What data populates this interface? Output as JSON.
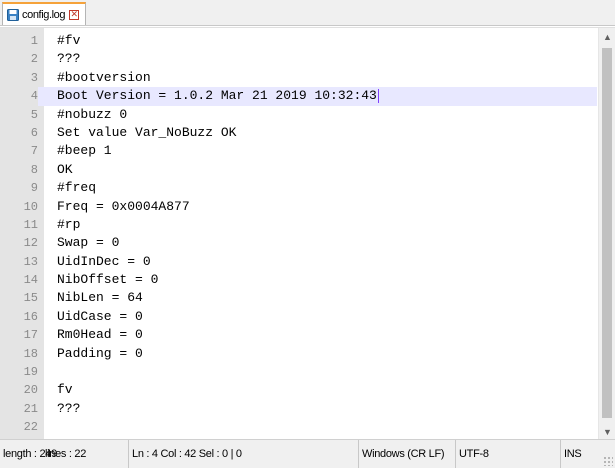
{
  "tab": {
    "label": "config.log",
    "icon": "save-icon",
    "close_icon": "close-icon"
  },
  "editor": {
    "lines": [
      {
        "n": "1",
        "text": "#fv"
      },
      {
        "n": "2",
        "text": "???"
      },
      {
        "n": "3",
        "text": "#bootversion"
      },
      {
        "n": "4",
        "text": "Boot Version = 1.0.2 Mar 21 2019 10:32:43"
      },
      {
        "n": "5",
        "text": "#nobuzz 0"
      },
      {
        "n": "6",
        "text": "Set value Var_NoBuzz OK"
      },
      {
        "n": "7",
        "text": "#beep 1"
      },
      {
        "n": "8",
        "text": "OK"
      },
      {
        "n": "9",
        "text": "#freq"
      },
      {
        "n": "10",
        "text": "Freq = 0x0004A877"
      },
      {
        "n": "11",
        "text": "#rp"
      },
      {
        "n": "12",
        "text": "Swap = 0"
      },
      {
        "n": "13",
        "text": "UidInDec = 0"
      },
      {
        "n": "14",
        "text": "NibOffset = 0"
      },
      {
        "n": "15",
        "text": "NibLen = 64"
      },
      {
        "n": "16",
        "text": "UidCase = 0"
      },
      {
        "n": "17",
        "text": "Rm0Head = 0"
      },
      {
        "n": "18",
        "text": "Padding = 0"
      },
      {
        "n": "19",
        "text": ""
      },
      {
        "n": "20",
        "text": "fv"
      },
      {
        "n": "21",
        "text": "???"
      },
      {
        "n": "22",
        "text": ""
      }
    ],
    "current_line": 4
  },
  "status": {
    "length": "length : 249",
    "lines": "lines : 22",
    "position": "Ln : 4    Col : 42    Sel : 0 | 0",
    "eol": "Windows (CR LF)",
    "encoding": "UTF-8",
    "mode": "INS"
  },
  "colors": {
    "current_line": "#e8e8ff",
    "gutter": "#e4e4e4",
    "tab_accent": "#f5a23a",
    "caret": "#8040ff"
  }
}
